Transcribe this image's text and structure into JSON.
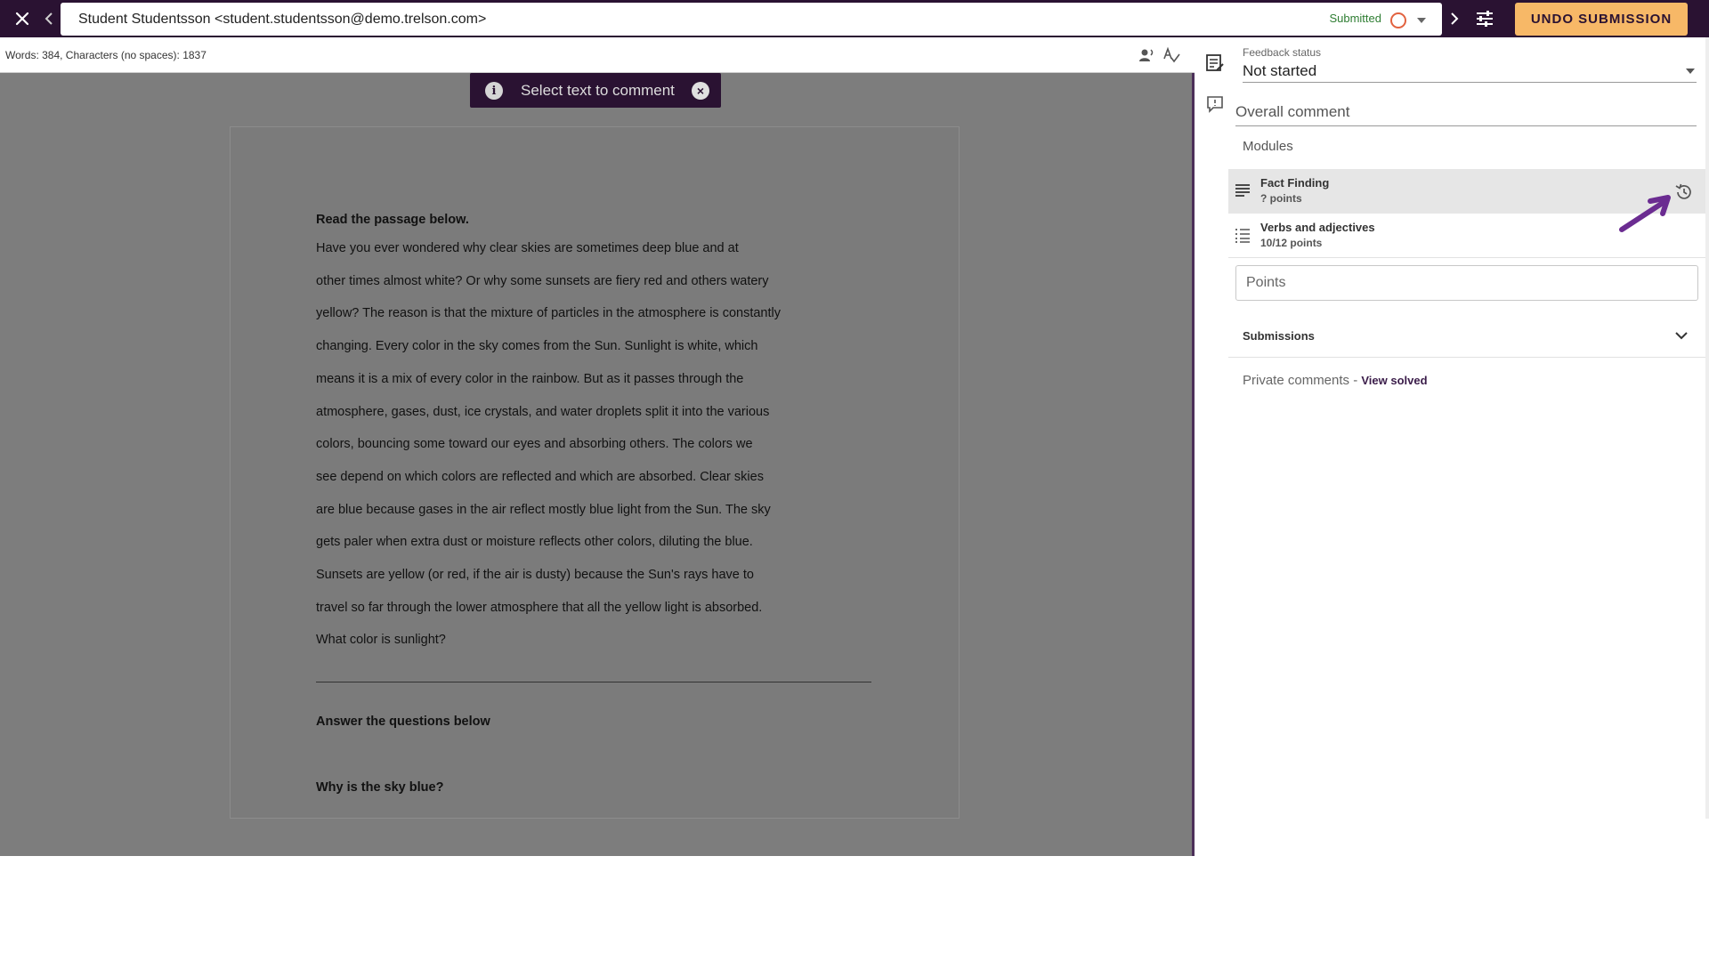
{
  "topbar": {
    "student": "Student Studentsson <student.studentsson@demo.trelson.com>",
    "submitted_label": "Submitted",
    "undo_label": "UNDO SUBMISSION"
  },
  "document": {
    "wordcount": "Words: 384, Characters (no spaces): 1837",
    "select_tip": "Select text to comment",
    "heading": "Read the passage below.",
    "passage_lines": [
      "Have you ever wondered why clear skies are sometimes deep blue and at",
      "other times almost white? Or why some sunsets are fiery red and others watery",
      "yellow? The reason is that the mixture of particles in the atmosphere is constantly",
      "changing. Every color in the sky comes from the Sun. Sunlight is white, which",
      "means it is a mix of every color in the rainbow. But as it passes through the",
      "atmosphere, gases, dust, ice crystals, and water droplets split it into the various",
      "colors, bouncing some toward our eyes and absorbing others. The colors we",
      "see depend on which colors are reflected and which are absorbed. Clear skies",
      "are blue because gases in the air reflect mostly blue light from the Sun. The sky",
      "gets paler when extra dust or moisture reflects other colors, diluting the blue.",
      "Sunsets are yellow (or red, if the air is dusty) because the Sun's rays have to",
      "travel so far through the lower atmosphere that all the yellow light is absorbed.",
      "What color is sunlight?"
    ],
    "answer_heading": "Answer the questions below",
    "question": "Why is the sky blue?"
  },
  "panel": {
    "feedback_status_label": "Feedback status",
    "feedback_status_value": "Not started",
    "overall_comment_placeholder": "Overall comment",
    "modules_label": "Modules",
    "modules": [
      {
        "title": "Fact Finding",
        "points": "? points"
      },
      {
        "title": "Verbs and adjectives",
        "points": "10/12 points"
      }
    ],
    "points_placeholder": "Points",
    "submissions_label": "Submissions",
    "private_comments": "Private comments - ",
    "view_solved": "View solved"
  },
  "colors": {
    "topbar": "#2a1232",
    "undo_button": "#f7b867",
    "submitted": "#2e7d32",
    "status_circle": "#e2623f",
    "annotation_arrow": "#6b2c91"
  },
  "icons": [
    "close-icon",
    "chevron-left-icon",
    "chevron-right-icon",
    "caret-down-icon",
    "sliders-icon",
    "text-to-speech-icon",
    "spellcheck-icon",
    "info-icon",
    "close-circle-icon",
    "feedback-icon",
    "comment-icon",
    "text-lines-icon",
    "list-icon",
    "history-icon",
    "chevron-down-icon"
  ]
}
